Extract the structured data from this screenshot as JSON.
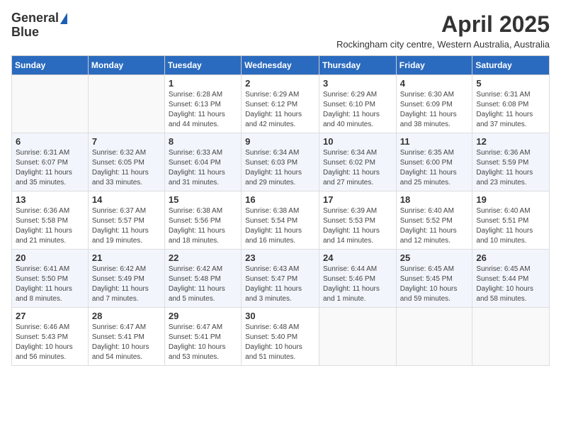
{
  "logo": {
    "line1": "General",
    "line2": "Blue"
  },
  "title": "April 2025",
  "subtitle": "Rockingham city centre, Western Australia, Australia",
  "days_of_week": [
    "Sunday",
    "Monday",
    "Tuesday",
    "Wednesday",
    "Thursday",
    "Friday",
    "Saturday"
  ],
  "weeks": [
    [
      {
        "day": "",
        "info": ""
      },
      {
        "day": "",
        "info": ""
      },
      {
        "day": "1",
        "info": "Sunrise: 6:28 AM\nSunset: 6:13 PM\nDaylight: 11 hours and 44 minutes."
      },
      {
        "day": "2",
        "info": "Sunrise: 6:29 AM\nSunset: 6:12 PM\nDaylight: 11 hours and 42 minutes."
      },
      {
        "day": "3",
        "info": "Sunrise: 6:29 AM\nSunset: 6:10 PM\nDaylight: 11 hours and 40 minutes."
      },
      {
        "day": "4",
        "info": "Sunrise: 6:30 AM\nSunset: 6:09 PM\nDaylight: 11 hours and 38 minutes."
      },
      {
        "day": "5",
        "info": "Sunrise: 6:31 AM\nSunset: 6:08 PM\nDaylight: 11 hours and 37 minutes."
      }
    ],
    [
      {
        "day": "6",
        "info": "Sunrise: 6:31 AM\nSunset: 6:07 PM\nDaylight: 11 hours and 35 minutes."
      },
      {
        "day": "7",
        "info": "Sunrise: 6:32 AM\nSunset: 6:05 PM\nDaylight: 11 hours and 33 minutes."
      },
      {
        "day": "8",
        "info": "Sunrise: 6:33 AM\nSunset: 6:04 PM\nDaylight: 11 hours and 31 minutes."
      },
      {
        "day": "9",
        "info": "Sunrise: 6:34 AM\nSunset: 6:03 PM\nDaylight: 11 hours and 29 minutes."
      },
      {
        "day": "10",
        "info": "Sunrise: 6:34 AM\nSunset: 6:02 PM\nDaylight: 11 hours and 27 minutes."
      },
      {
        "day": "11",
        "info": "Sunrise: 6:35 AM\nSunset: 6:00 PM\nDaylight: 11 hours and 25 minutes."
      },
      {
        "day": "12",
        "info": "Sunrise: 6:36 AM\nSunset: 5:59 PM\nDaylight: 11 hours and 23 minutes."
      }
    ],
    [
      {
        "day": "13",
        "info": "Sunrise: 6:36 AM\nSunset: 5:58 PM\nDaylight: 11 hours and 21 minutes."
      },
      {
        "day": "14",
        "info": "Sunrise: 6:37 AM\nSunset: 5:57 PM\nDaylight: 11 hours and 19 minutes."
      },
      {
        "day": "15",
        "info": "Sunrise: 6:38 AM\nSunset: 5:56 PM\nDaylight: 11 hours and 18 minutes."
      },
      {
        "day": "16",
        "info": "Sunrise: 6:38 AM\nSunset: 5:54 PM\nDaylight: 11 hours and 16 minutes."
      },
      {
        "day": "17",
        "info": "Sunrise: 6:39 AM\nSunset: 5:53 PM\nDaylight: 11 hours and 14 minutes."
      },
      {
        "day": "18",
        "info": "Sunrise: 6:40 AM\nSunset: 5:52 PM\nDaylight: 11 hours and 12 minutes."
      },
      {
        "day": "19",
        "info": "Sunrise: 6:40 AM\nSunset: 5:51 PM\nDaylight: 11 hours and 10 minutes."
      }
    ],
    [
      {
        "day": "20",
        "info": "Sunrise: 6:41 AM\nSunset: 5:50 PM\nDaylight: 11 hours and 8 minutes."
      },
      {
        "day": "21",
        "info": "Sunrise: 6:42 AM\nSunset: 5:49 PM\nDaylight: 11 hours and 7 minutes."
      },
      {
        "day": "22",
        "info": "Sunrise: 6:42 AM\nSunset: 5:48 PM\nDaylight: 11 hours and 5 minutes."
      },
      {
        "day": "23",
        "info": "Sunrise: 6:43 AM\nSunset: 5:47 PM\nDaylight: 11 hours and 3 minutes."
      },
      {
        "day": "24",
        "info": "Sunrise: 6:44 AM\nSunset: 5:46 PM\nDaylight: 11 hours and 1 minute."
      },
      {
        "day": "25",
        "info": "Sunrise: 6:45 AM\nSunset: 5:45 PM\nDaylight: 10 hours and 59 minutes."
      },
      {
        "day": "26",
        "info": "Sunrise: 6:45 AM\nSunset: 5:44 PM\nDaylight: 10 hours and 58 minutes."
      }
    ],
    [
      {
        "day": "27",
        "info": "Sunrise: 6:46 AM\nSunset: 5:43 PM\nDaylight: 10 hours and 56 minutes."
      },
      {
        "day": "28",
        "info": "Sunrise: 6:47 AM\nSunset: 5:41 PM\nDaylight: 10 hours and 54 minutes."
      },
      {
        "day": "29",
        "info": "Sunrise: 6:47 AM\nSunset: 5:41 PM\nDaylight: 10 hours and 53 minutes."
      },
      {
        "day": "30",
        "info": "Sunrise: 6:48 AM\nSunset: 5:40 PM\nDaylight: 10 hours and 51 minutes."
      },
      {
        "day": "",
        "info": ""
      },
      {
        "day": "",
        "info": ""
      },
      {
        "day": "",
        "info": ""
      }
    ]
  ]
}
